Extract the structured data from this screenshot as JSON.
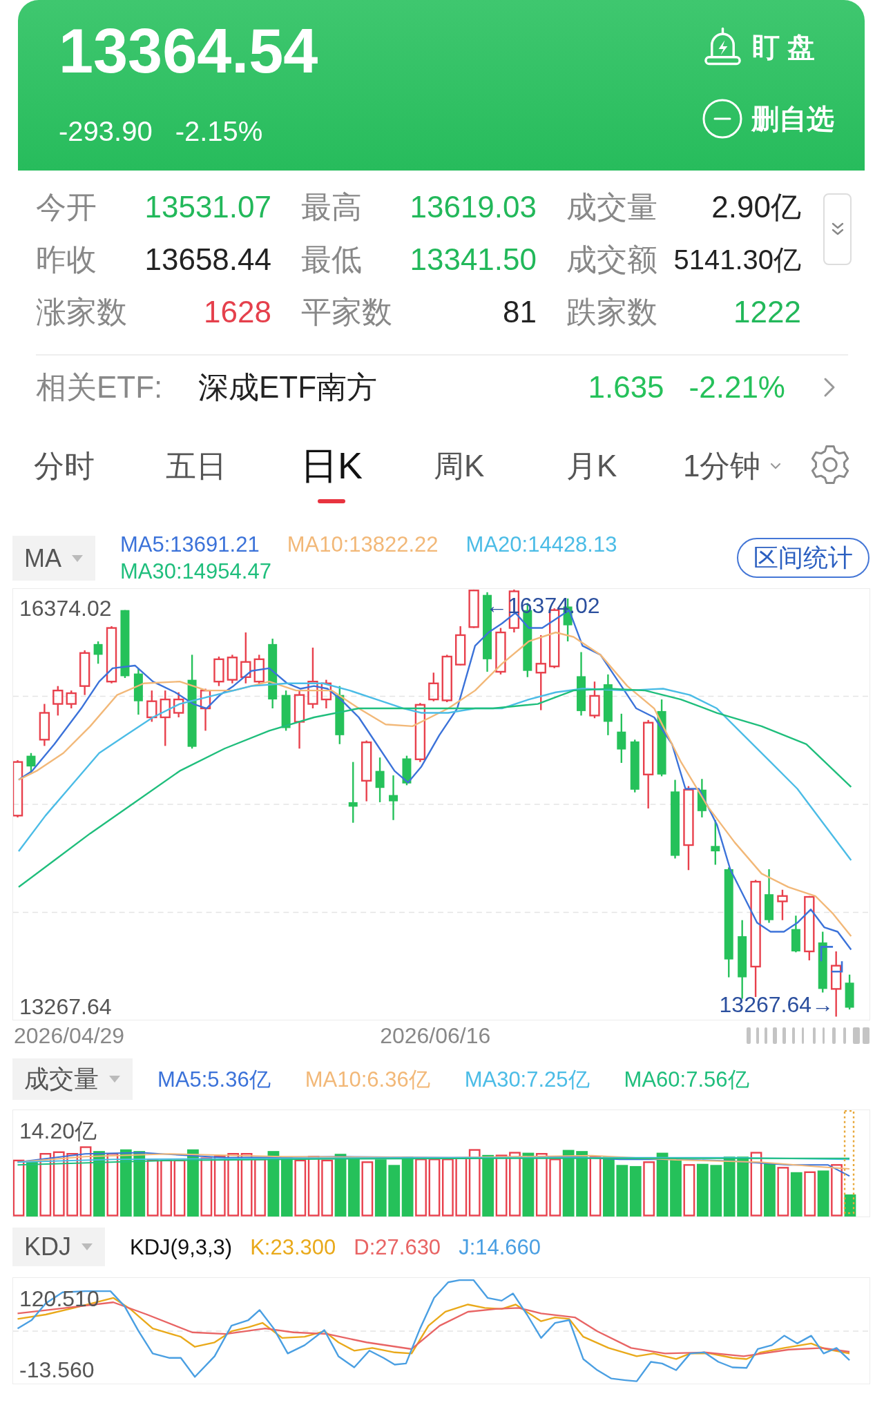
{
  "quote": {
    "price": "13364.54",
    "change": "-293.90",
    "change_percent": "-2.15%",
    "actions": [
      {
        "kind": "alert",
        "label": "盯 盘"
      },
      {
        "kind": "remove_watchlist",
        "label": "删自选"
      }
    ]
  },
  "stats": [
    [
      {
        "label": "今开",
        "value": "13531.07",
        "color": "#22b85a"
      },
      {
        "label": "最高",
        "value": "13619.03",
        "color": "#22b85a"
      },
      {
        "label": "成交量",
        "value": "2.90亿",
        "color": "#222222"
      }
    ],
    [
      {
        "label": "昨收",
        "value": "13658.44",
        "color": "#222222"
      },
      {
        "label": "最低",
        "value": "13341.50",
        "color": "#22b85a"
      },
      {
        "label": "成交额",
        "value": "5141.30亿",
        "color": "#222222"
      }
    ],
    [
      {
        "label": "涨家数",
        "value": "1628",
        "color": "#e5404c"
      },
      {
        "label": "平家数",
        "value": "81",
        "color": "#222222"
      },
      {
        "label": "跌家数",
        "value": "1222",
        "color": "#22b85a"
      }
    ]
  ],
  "related_etf": {
    "label": "相关ETF:",
    "name": "深成ETF南方",
    "price": "1.635",
    "change_percent": "-2.21%"
  },
  "period_tabs": [
    {
      "label": "分时",
      "selected": false,
      "kind": "tab"
    },
    {
      "label": "五日",
      "selected": false,
      "kind": "tab"
    },
    {
      "label": "日K",
      "selected": true,
      "kind": "tab"
    },
    {
      "label": "周K",
      "selected": false,
      "kind": "tab"
    },
    {
      "label": "月K",
      "selected": false,
      "kind": "tab"
    },
    {
      "label": "1分钟",
      "selected": false,
      "kind": "dropdown"
    }
  ],
  "price_chart": {
    "indicator": "MA",
    "legend": [
      {
        "label": "MA5:13691.21",
        "color": "#3b72d9"
      },
      {
        "label": "MA10:13822.22",
        "color": "#f2b878"
      },
      {
        "label": "MA20:14428.13",
        "color": "#4bbce6"
      },
      {
        "label": "MA30:14954.47",
        "color": "#1fbe7c"
      }
    ],
    "range_button": "区间统计",
    "max_label": "16374.02",
    "min_label": "13267.64",
    "high_marker": "←16374.02",
    "low_marker": "13267.64→",
    "dates": [
      "2026/04/29",
      "2026/06/16"
    ]
  },
  "volume_chart": {
    "indicator": "成交量",
    "legend": [
      {
        "label": "MA5:5.36亿",
        "color": "#3b72d9"
      },
      {
        "label": "MA10:6.36亿",
        "color": "#f2b878"
      },
      {
        "label": "MA30:7.25亿",
        "color": "#4bbce6"
      },
      {
        "label": "MA60:7.56亿",
        "color": "#1fbe7c"
      }
    ],
    "max_label": "14.20亿"
  },
  "kdj_chart": {
    "indicator": "KDJ",
    "params": "KDJ(9,3,3)",
    "legend": [
      {
        "label": "K:23.300",
        "color": "#e9a91a"
      },
      {
        "label": "D:27.630",
        "color": "#e86464"
      },
      {
        "label": "J:14.660",
        "color": "#4a9fe2"
      }
    ],
    "max_label": "120.510",
    "min_label": "-13.560"
  }
}
